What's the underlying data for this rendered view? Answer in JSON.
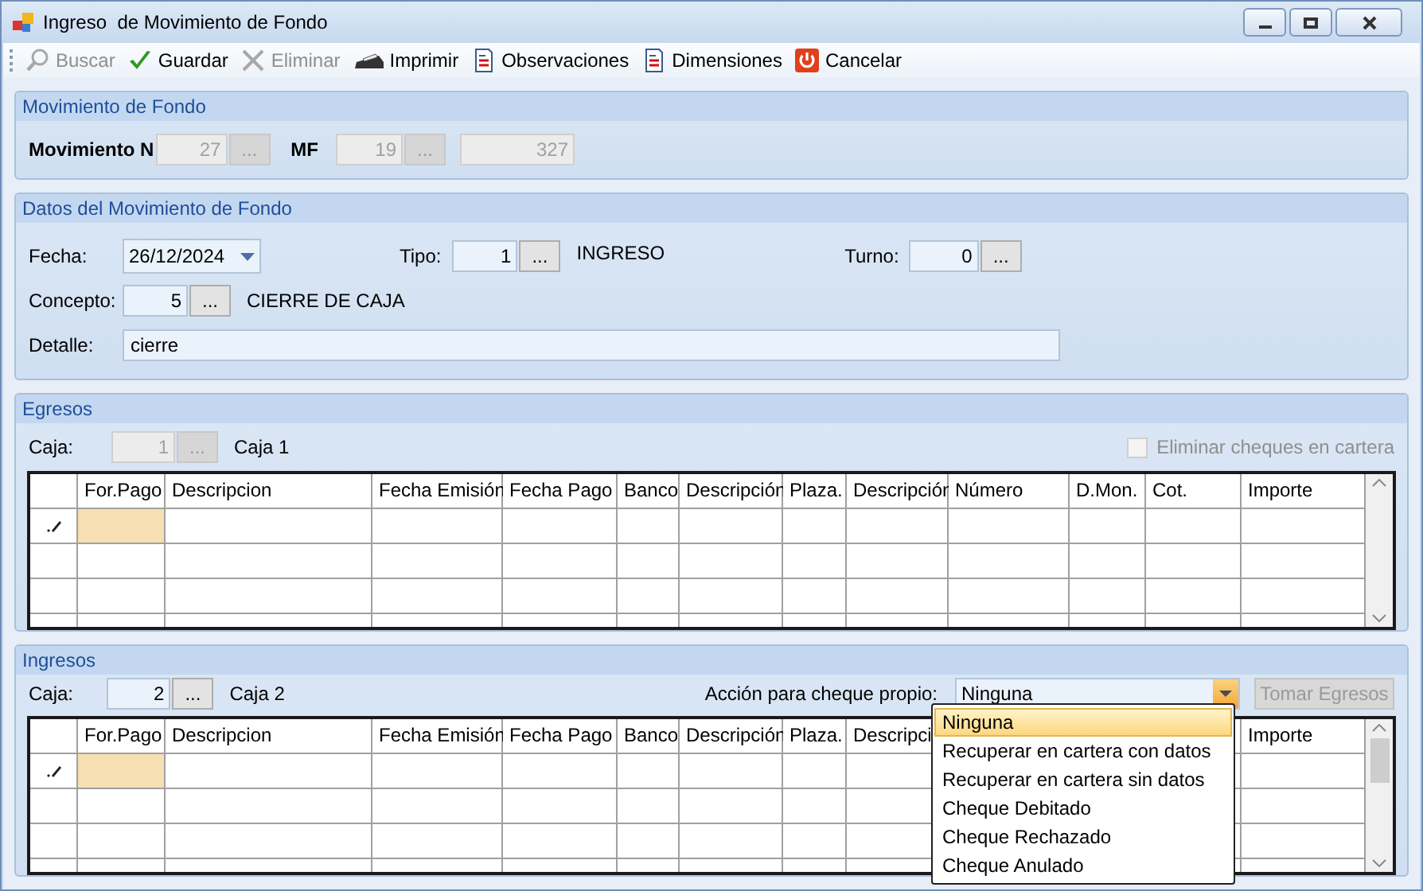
{
  "window": {
    "title": "Ingreso  de Movimiento de Fondo"
  },
  "toolbar": [
    {
      "label": "Buscar",
      "disabled": true
    },
    {
      "label": "Guardar",
      "disabled": false
    },
    {
      "label": "Eliminar",
      "disabled": true
    },
    {
      "label": "Imprimir",
      "disabled": false
    },
    {
      "label": "Observaciones",
      "disabled": false
    },
    {
      "label": "Dimensiones",
      "disabled": false
    },
    {
      "label": "Cancelar",
      "disabled": false
    }
  ],
  "movimiento": {
    "title": "Movimiento de Fondo",
    "numero_label": "Movimiento N",
    "numero": {
      "value": "27",
      "button": "...",
      "disabled": true
    },
    "mf_label": "MF",
    "mf": {
      "value": "19",
      "button": "...",
      "disabled": true
    },
    "total": {
      "value": "327",
      "disabled": true
    }
  },
  "datos": {
    "title": "Datos del Movimiento de Fondo",
    "fecha_label": "Fecha:",
    "fecha": "26/12/2024",
    "tipo_label": "Tipo:",
    "tipo": {
      "value": "1",
      "button": "...",
      "disabled": false
    },
    "tipo_text": "INGRESO",
    "turno_label": "Turno:",
    "turno": {
      "value": "0",
      "button": "...",
      "disabled": false
    },
    "concepto_label": "Concepto:",
    "concepto": {
      "value": "5",
      "button": "...",
      "disabled": false
    },
    "concepto_text": "CIERRE DE CAJA",
    "detalle_label": "Detalle:",
    "detalle": "cierre"
  },
  "egresos": {
    "title": "Egresos",
    "caja_label": "Caja:",
    "caja": {
      "value": "1",
      "button": "...",
      "disabled": true
    },
    "caja_text": "Caja 1",
    "checkbox": {
      "label": "Eliminar cheques en cartera",
      "checked": false,
      "disabled": true
    },
    "columns": [
      "For.Pago",
      "Descripcion",
      "Fecha Emisión",
      "Fecha Pago",
      "Banco",
      "Descripción",
      "Plaza.",
      "Descripción",
      "Número",
      "D.Mon.",
      "Cot.",
      "Importe"
    ],
    "rows": [
      {
        "editing": true
      },
      {
        "editing": false
      },
      {
        "editing": false
      },
      {
        "editing": false
      }
    ]
  },
  "ingresos": {
    "title": "Ingresos",
    "caja_label": "Caja:",
    "caja": {
      "value": "2",
      "button": "...",
      "disabled": false
    },
    "caja_text": "Caja 2",
    "accion_label": "Acción para cheque propio:",
    "accion": "Ninguna",
    "button": {
      "label": "Tomar Egresos",
      "disabled": true
    },
    "columns": [
      "For.Pago",
      "Descripcion",
      "Fecha Emisión",
      "Fecha Pago",
      "Banco",
      "Descripción",
      "Plaza.",
      "Descripci",
      "Importe"
    ],
    "rows": [
      {
        "editing": true
      },
      {
        "editing": false
      },
      {
        "editing": false
      },
      {
        "editing": false
      }
    ],
    "dropdown": [
      {
        "label": "Ninguna",
        "selected": true
      },
      {
        "label": "Recuperar en cartera con datos",
        "selected": false
      },
      {
        "label": "Recuperar en cartera sin datos",
        "selected": false
      },
      {
        "label": "Cheque Debitado",
        "selected": false
      },
      {
        "label": "Cheque Rechazado",
        "selected": false
      },
      {
        "label": "Cheque Anulado",
        "selected": false
      }
    ]
  }
}
